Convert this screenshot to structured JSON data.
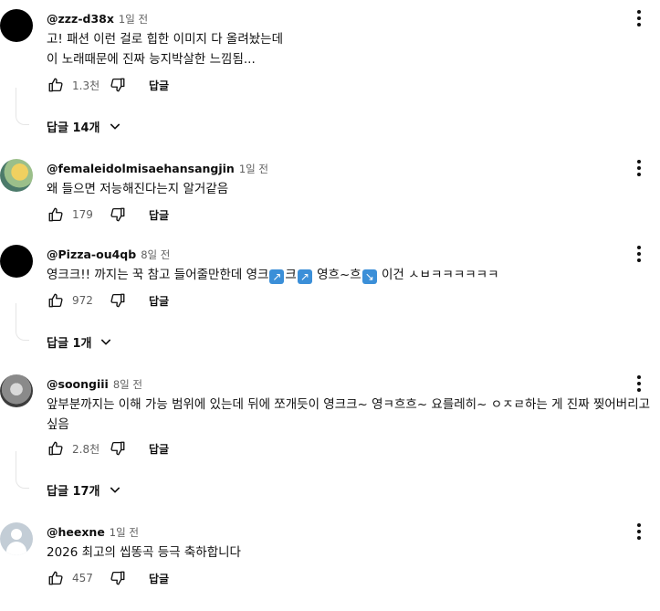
{
  "comments": [
    {
      "author": "@zzz-d38x",
      "time": "1일 전",
      "lines": [
        "고! 패션 이런 걸로 힙한 이미지 다 올려놨는데",
        "이 노래때문에 진짜 능지박살한 느낌됨..."
      ],
      "likes": "1.3천",
      "reply_label": "답글",
      "replies_label": "답글 14개",
      "avatar": "black"
    },
    {
      "author": "@femaleidolmisaehansangjin",
      "time": "1일 전",
      "lines": [
        "왜 들으면 저능해진다는지 알거같음"
      ],
      "likes": "179",
      "reply_label": "답글",
      "avatar": "image"
    },
    {
      "author": "@Pizza-ou4qb",
      "time": "8일 전",
      "line_parts": [
        "영크크!! 까지는 꾹 참고 들어줄만한데 영크",
        "크",
        " 영흐~흐",
        " 이건 ㅅㅂㅋㅋㅋㅋㅋㅋ"
      ],
      "emoji": [
        "↗",
        "↗",
        "↘"
      ],
      "likes": "972",
      "reply_label": "답글",
      "replies_label": "답글 1개",
      "avatar": "black"
    },
    {
      "author": "@soongiii",
      "time": "8일 전",
      "lines": [
        "앞부분까지는 이해 가능 범위에 있는데 뒤에 쪼개듯이 영크크~ 영ㅋ흐흐~ 요를레히~ ㅇㅈㄹ하는 게 진짜 찢어버리고",
        "싶음"
      ],
      "likes": "2.8천",
      "reply_label": "답글",
      "replies_label": "답글 17개",
      "avatar": "image2"
    },
    {
      "author": "@heexne",
      "time": "1일 전",
      "lines": [
        "2026 최고의 씹똥곡 등극 축하합니다"
      ],
      "likes": "457",
      "reply_label": "답글",
      "avatar": "default"
    }
  ],
  "icons": {
    "like": "thumbs-up-icon",
    "dislike": "thumbs-down-icon",
    "menu": "more-vert-icon",
    "expand": "chevron-down-icon"
  }
}
